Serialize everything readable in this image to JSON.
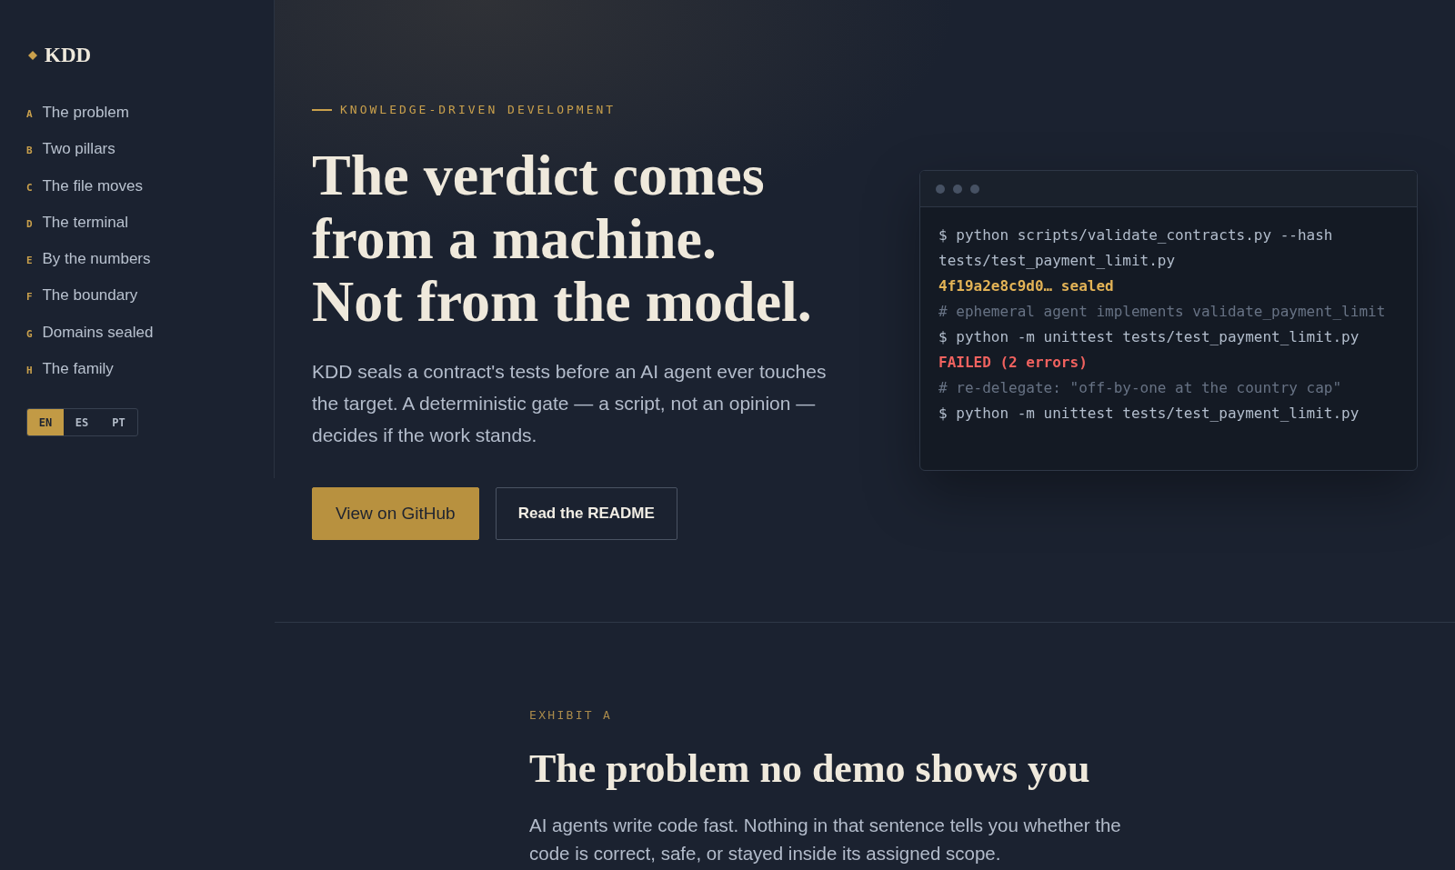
{
  "sidebar": {
    "logo": "KDD",
    "nav_items": [
      {
        "letter": "A",
        "label": "The problem"
      },
      {
        "letter": "B",
        "label": "Two pillars"
      },
      {
        "letter": "C",
        "label": "The file moves"
      },
      {
        "letter": "D",
        "label": "The terminal"
      },
      {
        "letter": "E",
        "label": "By the numbers"
      },
      {
        "letter": "F",
        "label": "The boundary"
      },
      {
        "letter": "G",
        "label": "Domains sealed"
      },
      {
        "letter": "H",
        "label": "The family"
      }
    ],
    "languages": [
      {
        "label": "EN",
        "selected": true
      },
      {
        "label": "ES",
        "selected": false
      },
      {
        "label": "PT",
        "selected": false
      }
    ]
  },
  "hero": {
    "eyebrow": "KNOWLEDGE-DRIVEN DEVELOPMENT",
    "title_lines": [
      "The verdict comes",
      "from a machine.",
      "Not from the model."
    ],
    "lede": "KDD seals a contract's tests before an AI agent ever touches the target. A deterministic gate — a script, not an opinion — decides if the work stands.",
    "buttons": [
      {
        "label": "View on GitHub",
        "kind": "primary"
      },
      {
        "label": "Read the README",
        "kind": "secondary"
      }
    ]
  },
  "terminal": {
    "lines": [
      {
        "kind": "command",
        "text": "$ python scripts/validate_contracts.py --hash tests/test_payment_limit.py"
      },
      {
        "kind": "success",
        "text": "4f19a2e8c9d0… sealed"
      },
      {
        "kind": "comment",
        "text": "# ephemeral agent implements validate_payment_limit"
      },
      {
        "kind": "command",
        "text": "$ python -m unittest tests/test_payment_limit.py"
      },
      {
        "kind": "error",
        "text": "FAILED (2 errors)"
      },
      {
        "kind": "comment",
        "text": "# re-delegate: \"off-by-one at the country cap\""
      },
      {
        "kind": "command",
        "text": "$ python -m unittest tests/test_payment_limit.py"
      }
    ]
  },
  "section": {
    "eyebrow": "EXHIBIT A",
    "title": "The problem no demo shows you",
    "body": "AI agents write code fast. Nothing in that sentence tells you whether the code is correct, safe, or stayed inside its assigned scope."
  }
}
